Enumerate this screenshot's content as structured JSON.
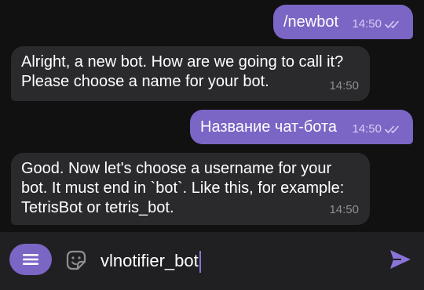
{
  "messages": [
    {
      "direction": "out",
      "text": "/newbot",
      "time": "14:50",
      "status": "read"
    },
    {
      "direction": "in",
      "lines": [
        "Alright, a new bot. How are we going to call it?",
        "Please choose a name for your bot."
      ],
      "time": "14:50"
    },
    {
      "direction": "out",
      "text": "Название чат-бота",
      "time": "14:50",
      "status": "read"
    },
    {
      "direction": "in",
      "lines": [
        "Good. Now let's choose a username for your",
        "bot. It must end in `bot`. Like this, for example:",
        "TetrisBot or tetris_bot."
      ],
      "time": "14:50"
    }
  ],
  "composer": {
    "value": "vlnotifier_bot",
    "menu_icon": "hamburger-menu-icon",
    "sticker_icon": "sticker-icon",
    "send_icon": "send-icon"
  },
  "colors": {
    "background": "#111111",
    "outgoing_bubble": "#7b65c5",
    "incoming_bubble": "#2a2a2d",
    "composer_bar": "#202022",
    "accent": "#8a73d6"
  }
}
